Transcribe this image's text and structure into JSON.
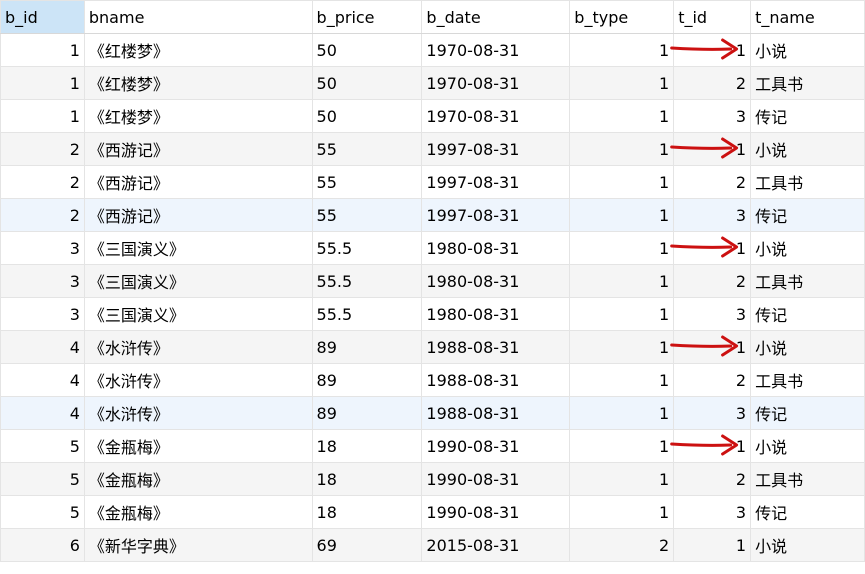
{
  "columns": [
    {
      "key": "b_id",
      "label": "b_id",
      "align": "num",
      "width": 84,
      "selected": true
    },
    {
      "key": "bname",
      "label": "bname",
      "align": "txt",
      "width": 228
    },
    {
      "key": "b_price",
      "label": "b_price",
      "align": "txt",
      "width": 110
    },
    {
      "key": "b_date",
      "label": "b_date",
      "align": "txt",
      "width": 148
    },
    {
      "key": "b_type",
      "label": "b_type",
      "align": "num",
      "width": 104
    },
    {
      "key": "t_id",
      "label": "t_id",
      "align": "num",
      "width": 77
    },
    {
      "key": "t_name",
      "label": "t_name",
      "align": "txt",
      "width": 114
    }
  ],
  "rows": [
    {
      "b_id": "1",
      "bname": "《红楼梦》",
      "b_price": "50",
      "b_date": "1970-08-31",
      "b_type": "1",
      "t_id": "1",
      "t_name": "小说",
      "arrow": true
    },
    {
      "b_id": "1",
      "bname": "《红楼梦》",
      "b_price": "50",
      "b_date": "1970-08-31",
      "b_type": "1",
      "t_id": "2",
      "t_name": "工具书"
    },
    {
      "b_id": "1",
      "bname": "《红楼梦》",
      "b_price": "50",
      "b_date": "1970-08-31",
      "b_type": "1",
      "t_id": "3",
      "t_name": "传记"
    },
    {
      "b_id": "2",
      "bname": "《西游记》",
      "b_price": "55",
      "b_date": "1997-08-31",
      "b_type": "1",
      "t_id": "1",
      "t_name": "小说",
      "arrow": true
    },
    {
      "b_id": "2",
      "bname": "《西游记》",
      "b_price": "55",
      "b_date": "1997-08-31",
      "b_type": "1",
      "t_id": "2",
      "t_name": "工具书"
    },
    {
      "b_id": "2",
      "bname": "《西游记》",
      "b_price": "55",
      "b_date": "1997-08-31",
      "b_type": "1",
      "t_id": "3",
      "t_name": "传记",
      "hover": true
    },
    {
      "b_id": "3",
      "bname": "《三国演义》",
      "b_price": "55.5",
      "b_date": "1980-08-31",
      "b_type": "1",
      "t_id": "1",
      "t_name": "小说",
      "arrow": true
    },
    {
      "b_id": "3",
      "bname": "《三国演义》",
      "b_price": "55.5",
      "b_date": "1980-08-31",
      "b_type": "1",
      "t_id": "2",
      "t_name": "工具书"
    },
    {
      "b_id": "3",
      "bname": "《三国演义》",
      "b_price": "55.5",
      "b_date": "1980-08-31",
      "b_type": "1",
      "t_id": "3",
      "t_name": "传记"
    },
    {
      "b_id": "4",
      "bname": "《水浒传》",
      "b_price": "89",
      "b_date": "1988-08-31",
      "b_type": "1",
      "t_id": "1",
      "t_name": "小说",
      "arrow": true
    },
    {
      "b_id": "4",
      "bname": "《水浒传》",
      "b_price": "89",
      "b_date": "1988-08-31",
      "b_type": "1",
      "t_id": "2",
      "t_name": "工具书"
    },
    {
      "b_id": "4",
      "bname": "《水浒传》",
      "b_price": "89",
      "b_date": "1988-08-31",
      "b_type": "1",
      "t_id": "3",
      "t_name": "传记",
      "hover": true
    },
    {
      "b_id": "5",
      "bname": "《金瓶梅》",
      "b_price": "18",
      "b_date": "1990-08-31",
      "b_type": "1",
      "t_id": "1",
      "t_name": "小说",
      "arrow": true
    },
    {
      "b_id": "5",
      "bname": "《金瓶梅》",
      "b_price": "18",
      "b_date": "1990-08-31",
      "b_type": "1",
      "t_id": "2",
      "t_name": "工具书"
    },
    {
      "b_id": "5",
      "bname": "《金瓶梅》",
      "b_price": "18",
      "b_date": "1990-08-31",
      "b_type": "1",
      "t_id": "3",
      "t_name": "传记"
    },
    {
      "b_id": "6",
      "bname": "《新华字典》",
      "b_price": "69",
      "b_date": "2015-08-31",
      "b_type": "2",
      "t_id": "1",
      "t_name": "小说"
    }
  ],
  "colors": {
    "arrow": "#cc1111",
    "header_selected": "#cce4f7",
    "grid_line": "#e4e4e4",
    "row_alt": "#f5f5f5",
    "row_hover": "#eef5fd"
  }
}
